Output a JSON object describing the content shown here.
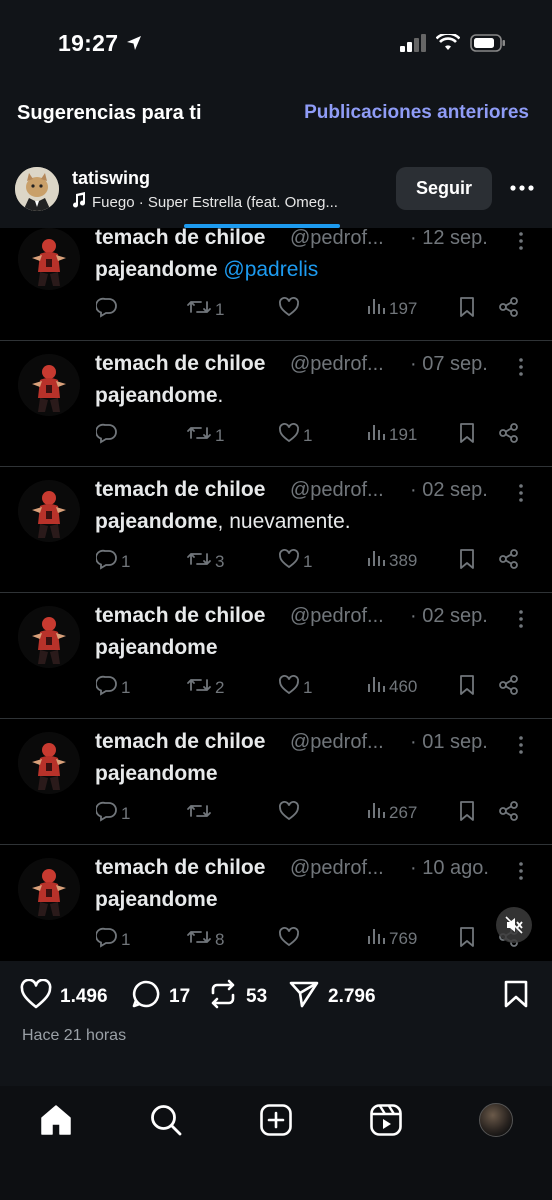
{
  "status_bar": {
    "time": "19:27"
  },
  "header": {
    "title": "Sugerencias para ti",
    "previous_posts": "Publicaciones anteriores"
  },
  "post": {
    "username": "tatiswing",
    "song": "Fuego · Super Estrella (feat. Omeg...",
    "follow_label": "Seguir"
  },
  "tweets": [
    {
      "name": "temach de chiloe",
      "handle": "@pedrof...",
      "date": "· 12 sep.",
      "text_bold": "pajeandome",
      "text_mention": " @padrelis",
      "text_rest": "",
      "replies": "",
      "retweets": "1",
      "likes": "",
      "views": "197"
    },
    {
      "name": "temach de chiloe",
      "handle": "@pedrof...",
      "date": "· 07 sep.",
      "text_bold": "pajeandome",
      "text_mention": "",
      "text_rest": ".",
      "replies": "",
      "retweets": "1",
      "likes": "1",
      "views": "191"
    },
    {
      "name": "temach de chiloe",
      "handle": "@pedrof...",
      "date": "· 02 sep.",
      "text_bold": "pajeandome",
      "text_mention": "",
      "text_rest": ", nuevamente.",
      "replies": "1",
      "retweets": "3",
      "likes": "1",
      "views": "389"
    },
    {
      "name": "temach de chiloe",
      "handle": "@pedrof...",
      "date": "· 02 sep.",
      "text_bold": "pajeandome",
      "text_mention": "",
      "text_rest": "",
      "replies": "1",
      "retweets": "2",
      "likes": "1",
      "views": "460"
    },
    {
      "name": "temach de chiloe",
      "handle": "@pedrof...",
      "date": "· 01 sep.",
      "text_bold": "pajeandome",
      "text_mention": "",
      "text_rest": "",
      "replies": "1",
      "retweets": "",
      "likes": "",
      "views": "267"
    },
    {
      "name": "temach de chiloe",
      "handle": "@pedrof...",
      "date": "· 10 ago.",
      "text_bold": "pajeandome",
      "text_mention": "",
      "text_rest": "",
      "replies": "1",
      "retweets": "8",
      "likes": "",
      "views": "769"
    }
  ],
  "engagement": {
    "likes": "1.496",
    "comments": "17",
    "reposts": "53",
    "shares": "2.796",
    "time_ago": "Hace 21 horas"
  },
  "nav": {
    "icons": [
      "home-icon",
      "search-icon",
      "create-icon",
      "reels-icon",
      "profile-avatar"
    ]
  },
  "colors": {
    "accent_link": "#8f9cf6",
    "tweet_blue": "#1d9bf0",
    "background": "#111418",
    "tweet_bg": "#000000"
  }
}
